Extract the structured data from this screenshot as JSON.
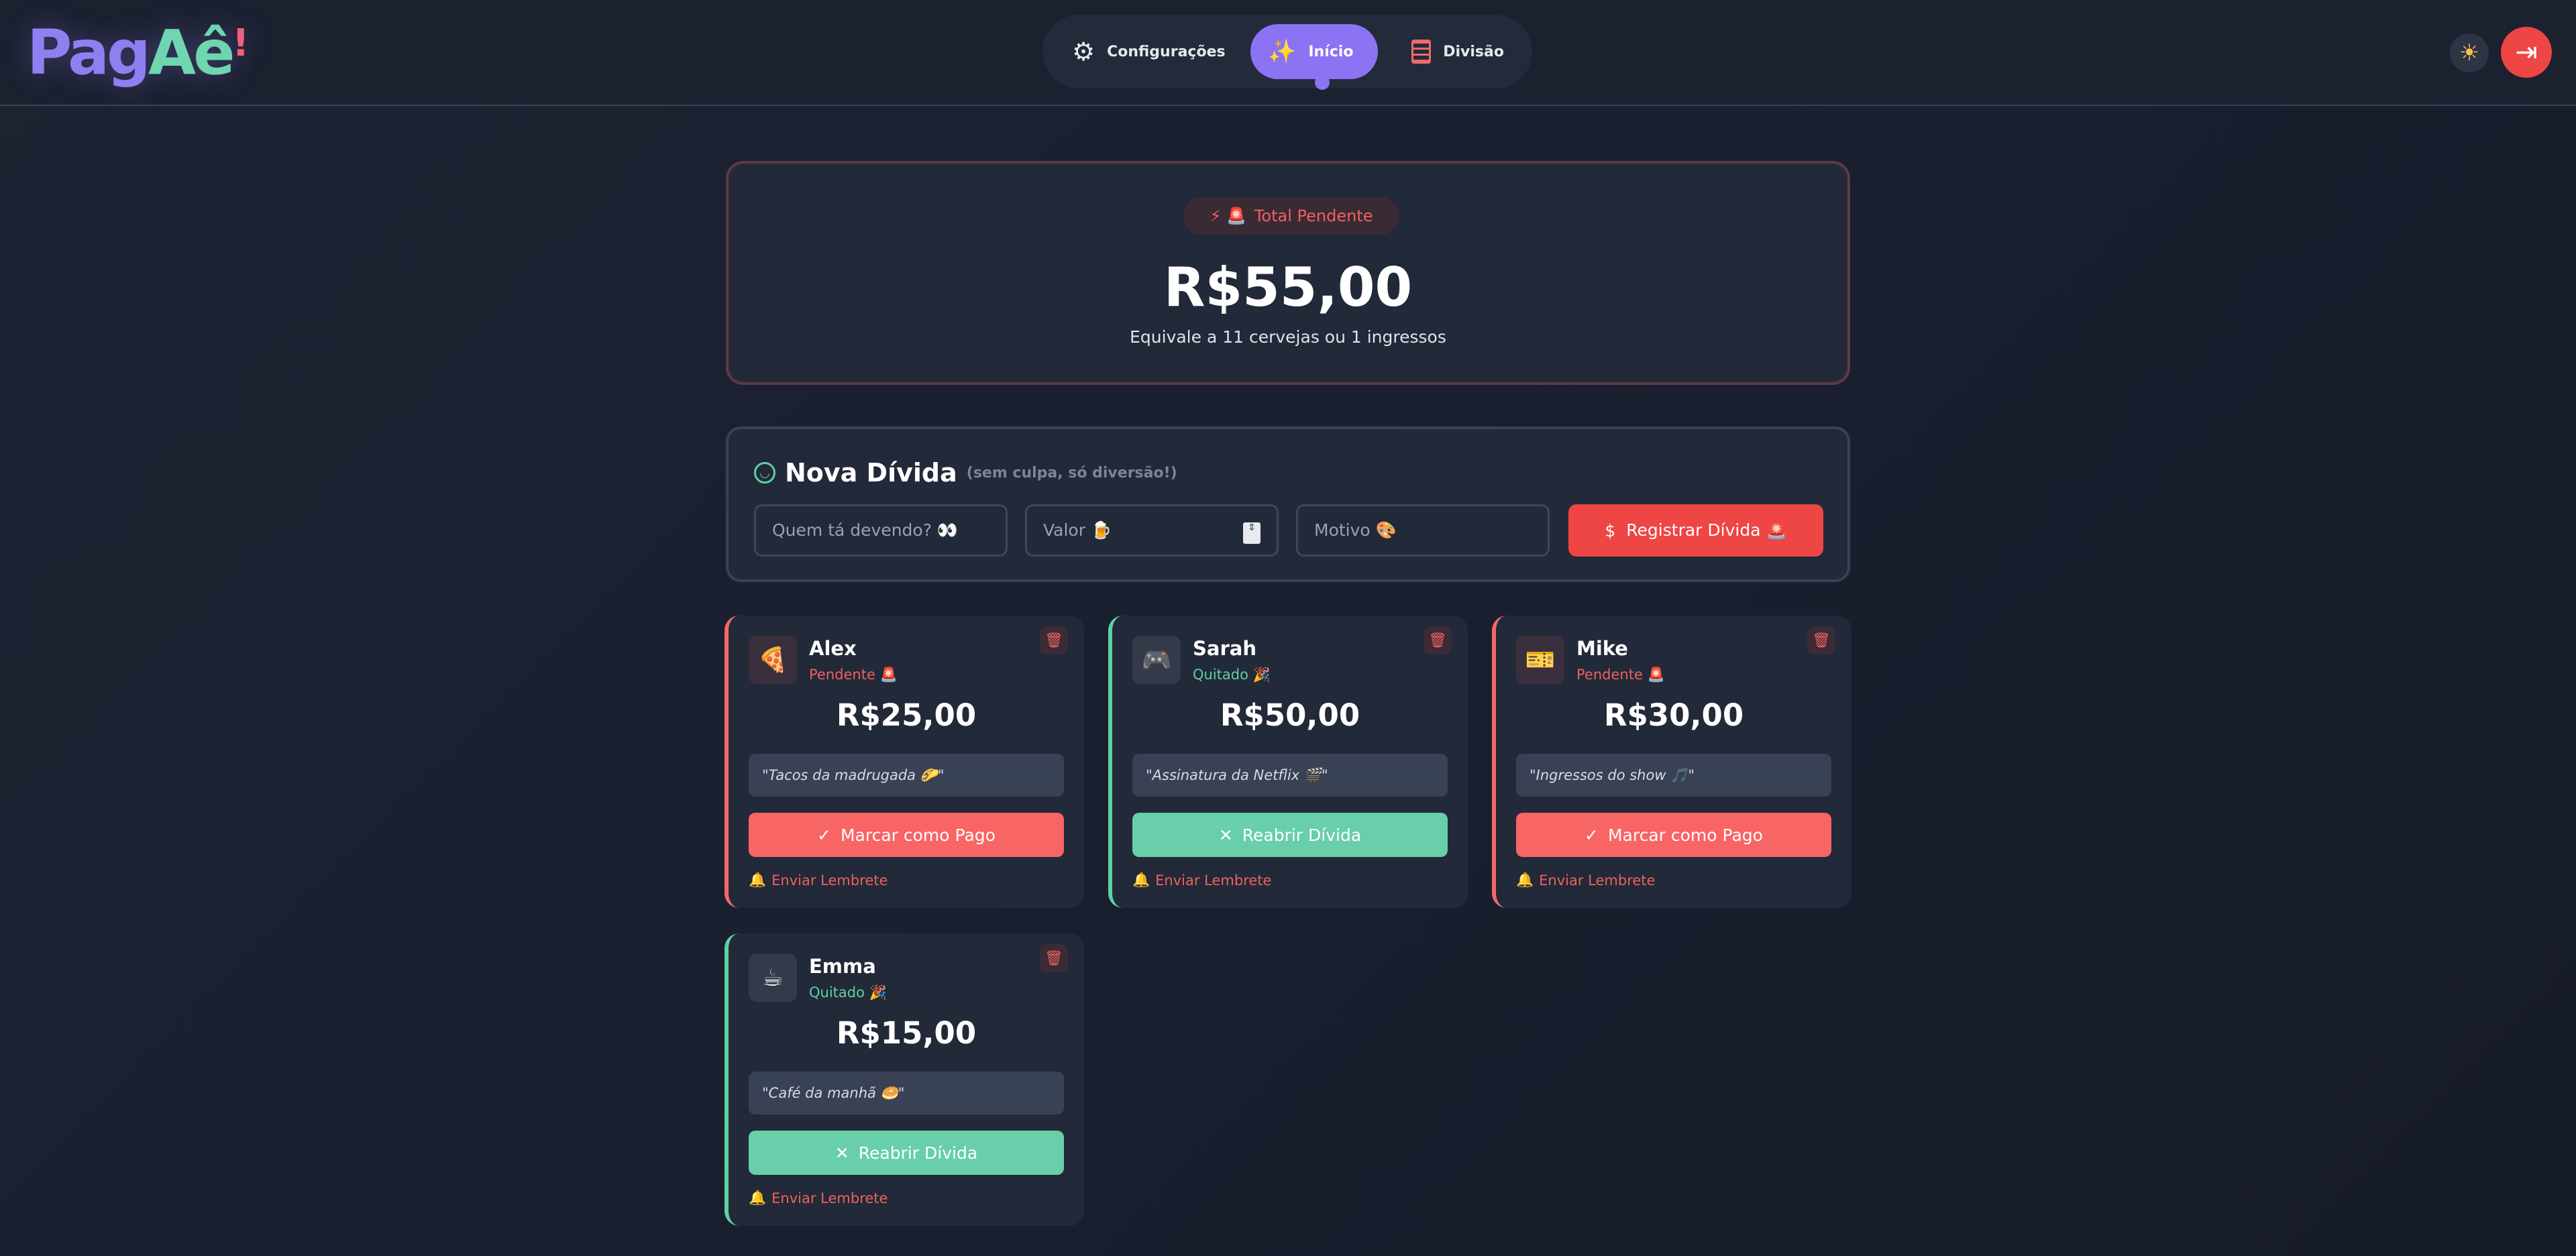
{
  "app": {
    "logo_main": "Pag",
    "logo_accent": "Aê",
    "logo_bang": "!"
  },
  "nav": {
    "items": [
      {
        "label": "Configurações",
        "icon": "gear-icon"
      },
      {
        "label": "Início",
        "icon": "sparkles-icon",
        "active": true
      },
      {
        "label": "Divisão",
        "icon": "table-icon"
      }
    ]
  },
  "header_actions": {
    "theme_icon": "☀",
    "logout_icon": "⇥"
  },
  "total": {
    "badge": "Total Pendente",
    "badge_icons": "⚡ 🚨",
    "amount": "R$55,00",
    "equivalent": "Equivale a 11 cervejas ou 1 ingressos"
  },
  "new_debt": {
    "title": "Nova Dívida",
    "subtitle": "(sem culpa, só diversão!)",
    "who_placeholder": "Quem tá devendo? 👀",
    "value_placeholder": "Valor 🍺",
    "reason_placeholder": "Motivo 🎨",
    "submit_label": "Registrar Dívida 🚨"
  },
  "debtors": [
    {
      "name": "Alex",
      "status": "Pendente 🚨",
      "avatar": "🍕",
      "amount": "R$25,00",
      "reason": "\"Tacos da madrugada 🌮\"",
      "action": "Marcar como Pago",
      "action_icon": "✓",
      "remind": "Enviar Lembrete",
      "paid": false
    },
    {
      "name": "Sarah",
      "status": "Quitado 🎉",
      "avatar": "🎮",
      "amount": "R$50,00",
      "reason": "\"Assinatura da Netflix 🎬\"",
      "action": "Reabrir Dívida",
      "action_icon": "✕",
      "remind": "Enviar Lembrete",
      "paid": true
    },
    {
      "name": "Mike",
      "status": "Pendente 🚨",
      "avatar": "🎫",
      "amount": "R$30,00",
      "reason": "\"Ingressos do show 🎵\"",
      "action": "Marcar como Pago",
      "action_icon": "✓",
      "remind": "Enviar Lembrete",
      "paid": false
    },
    {
      "name": "Emma",
      "status": "Quitado 🎉",
      "avatar": "☕",
      "amount": "R$15,00",
      "reason": "\"Café da manhã 🥯\"",
      "action": "Reabrir Dívida",
      "action_icon": "✕",
      "remind": "Enviar Lembrete",
      "paid": true
    }
  ],
  "colors": {
    "accent": "#8b73f4",
    "danger": "#ee4545",
    "success": "#5fd1a4",
    "background": "#1a2030"
  }
}
